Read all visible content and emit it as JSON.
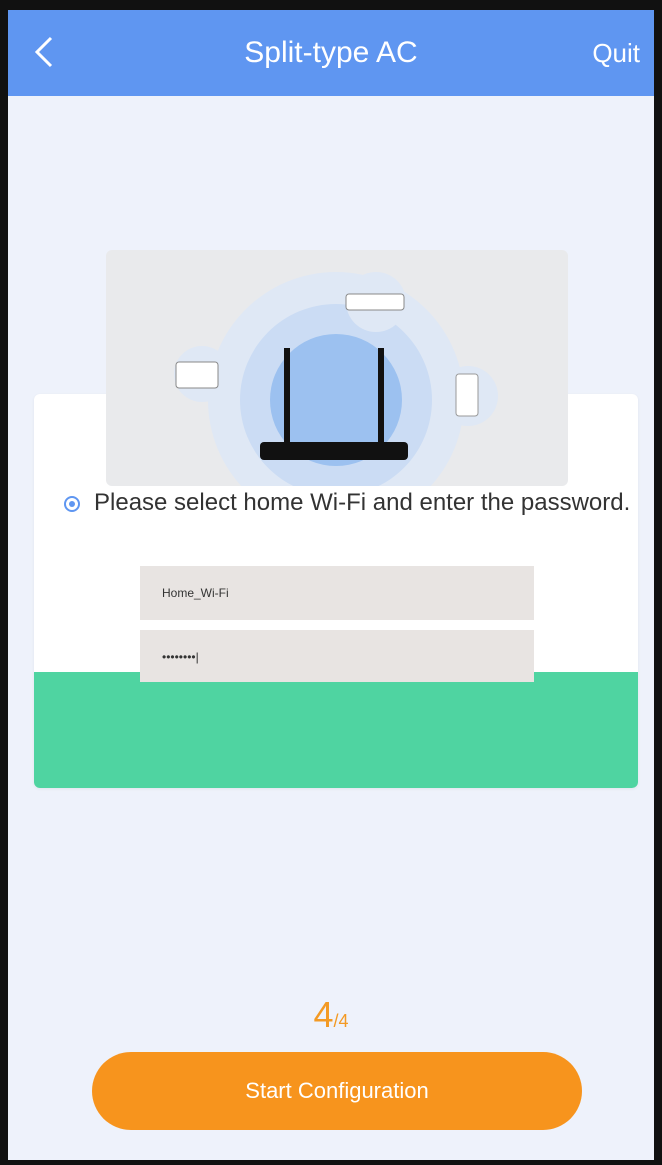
{
  "header": {
    "title": "Split-type AC",
    "quit_label": "Quit"
  },
  "instruction": {
    "text": "Please select home Wi-Fi and enter the password."
  },
  "wifi": {
    "ssid_value": "Home_Wi-Fi",
    "password_value": "••••••••|"
  },
  "step": {
    "current": "4",
    "total": "/4"
  },
  "actions": {
    "start_label": "Start Configuration"
  },
  "colors": {
    "header": "#5f96f1",
    "accent": "#f7941d",
    "green_panel": "#4fd4a1"
  }
}
